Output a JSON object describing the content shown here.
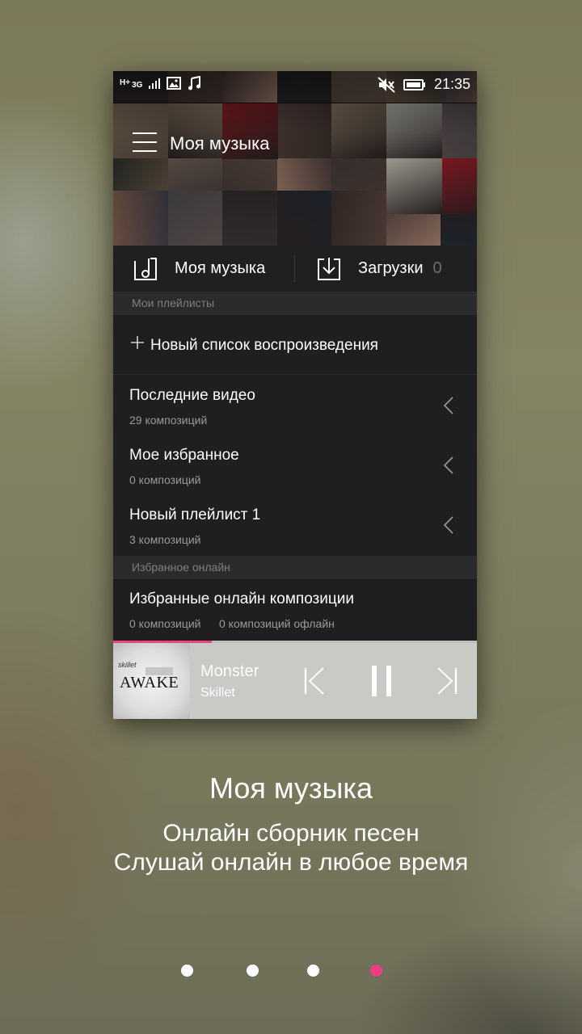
{
  "status_bar": {
    "network": "H+",
    "network_sub": "3G",
    "time": "21:35"
  },
  "app_bar": {
    "title": "Моя музыка"
  },
  "tabs": [
    {
      "label": "Моя музыка"
    },
    {
      "label": "Загрузки",
      "count": "0"
    }
  ],
  "sections": [
    {
      "title": "Мои плейлисты"
    },
    {
      "title": "Избранное онлайн"
    }
  ],
  "new_playlist_label": "Новый список воспроизведения",
  "playlists": [
    {
      "name": "Последние видео",
      "count": "29 композиций"
    },
    {
      "name": "Мое избранное",
      "count": "0 композиций"
    },
    {
      "name": "Новый плейлист 1",
      "count": "3 композиций"
    }
  ],
  "favorites_online": {
    "name": "Избранные онлайн композиции",
    "count": "0 композиций",
    "offline": "0 композиций офлайн"
  },
  "player": {
    "album_band": "skillet",
    "album_title": "AWAKE",
    "song": "Monster",
    "artist": "Skillet",
    "progress": 0.27,
    "accent": "#e8467e"
  },
  "caption": {
    "title": "Моя музыка",
    "line1": "Онлайн сборник песен",
    "line2": "Слушай онлайн в любое время"
  },
  "pager": {
    "pages": 4,
    "active": 3,
    "active_color": "#ea3f86"
  }
}
